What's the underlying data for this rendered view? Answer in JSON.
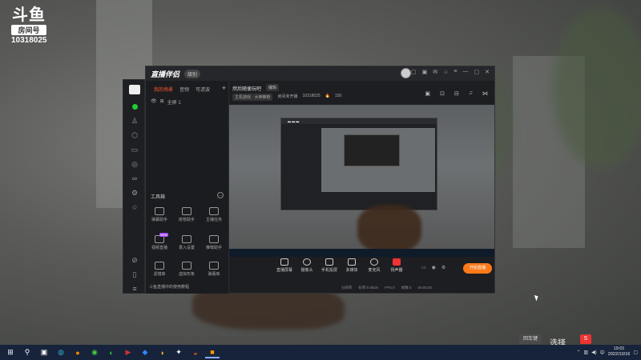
{
  "overlay": {
    "brand": "斗鱼",
    "room_label": "房间号",
    "room_number": "10318025"
  },
  "window": {
    "app_name": "直播伴侣",
    "vip_badge": "级别",
    "left_tabs": [
      "我的场景",
      "音频",
      "可滤波"
    ],
    "scene_row": [
      "全屏 1"
    ],
    "tools_title": "工具箱",
    "tools": [
      {
        "label": "弹幕助手"
      },
      {
        "label": "房管助手"
      },
      {
        "label": "主播任务"
      },
      {
        "label": "视频直播",
        "badge": "NEW"
      },
      {
        "label": "录入设置"
      },
      {
        "label": "推荐助手"
      },
      {
        "label": "滤镜库"
      },
      {
        "label": "虚拟形象"
      },
      {
        "label": "弹幕库"
      }
    ],
    "left_footer": "斗鱼直播中的使用教程",
    "room_title": "然后随便玩吧",
    "room_edit": "编辑",
    "room_category": "主机游戏 · 大神推荐",
    "room_status": "房间未开播",
    "room_id": "10318025",
    "popularity": "150",
    "controls": [
      "直播屏幕",
      "摄像头",
      "手机投屏",
      "多媒体",
      "麦克风",
      "扬声器"
    ],
    "start_button": "开始直播",
    "stats": [
      "分辨率",
      "码率:0.0kb/s",
      "FPS:0",
      "帧数:0",
      "00:00:00"
    ]
  },
  "desktop": {
    "danmaku_button": "回车键",
    "select_text": "选择",
    "ime_label": "S",
    "clock_time": "19:01",
    "clock_date": "2022/10/16"
  },
  "taskbar_icons": [
    "windows-icon",
    "search-icon",
    "taskview-icon",
    "edge-icon",
    "firefox-icon",
    "chrome-icon",
    "wechat-icon",
    "video-icon",
    "app-icon",
    "browser-icon",
    "cat-icon",
    "douyu-icon",
    "orange-app-icon"
  ]
}
